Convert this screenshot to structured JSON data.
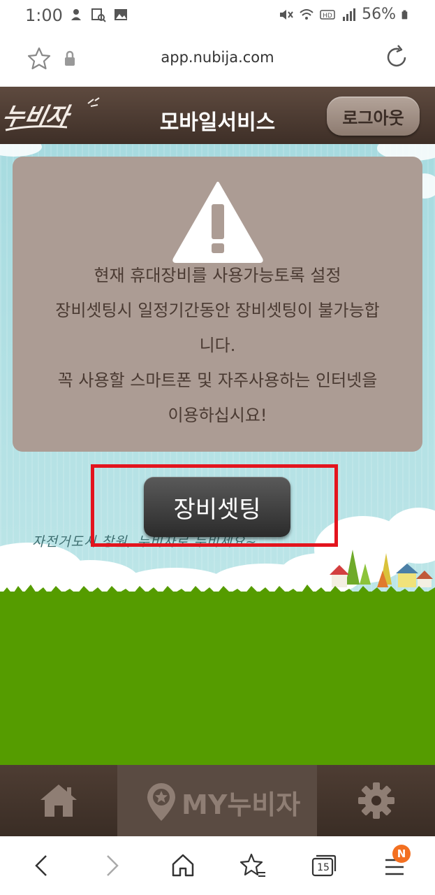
{
  "status_bar": {
    "time": "1:00",
    "battery": "56%",
    "icons": [
      "notification-icon",
      "image-search-icon",
      "gallery-icon",
      "mute-icon",
      "wifi-icon",
      "hd-icon",
      "signal-icon",
      "battery-icon"
    ]
  },
  "address_bar": {
    "url": "app.nubija.com"
  },
  "header": {
    "logo_text": "누비자",
    "title": "모바일서비스",
    "logout_label": "로그아웃"
  },
  "warning": {
    "lines": [
      "현재 휴대장비를 사용가능토록 설정",
      "장비셋팅시 일정기간동안 장비셋팅이 불가능합",
      "니다.",
      "꼭 사용할 스마트폰 및 자주사용하는 인터넷을",
      "이용하십시요!"
    ]
  },
  "device_setting_label": "장비셋팅",
  "tagline": "자전거도시 창원, 누비자로 누비세요~",
  "bottom_nav": {
    "my_label": "MY누비자"
  },
  "toolbar": {
    "tab_count": "15",
    "badge": "N"
  },
  "colors": {
    "header_brown": "#4a3a31",
    "panel_taupe": "#ac9c94",
    "highlight_red": "#e3141e",
    "grass_green": "#559c00",
    "sky_blue": "#a7dbe0",
    "badge_orange": "#f37021"
  }
}
